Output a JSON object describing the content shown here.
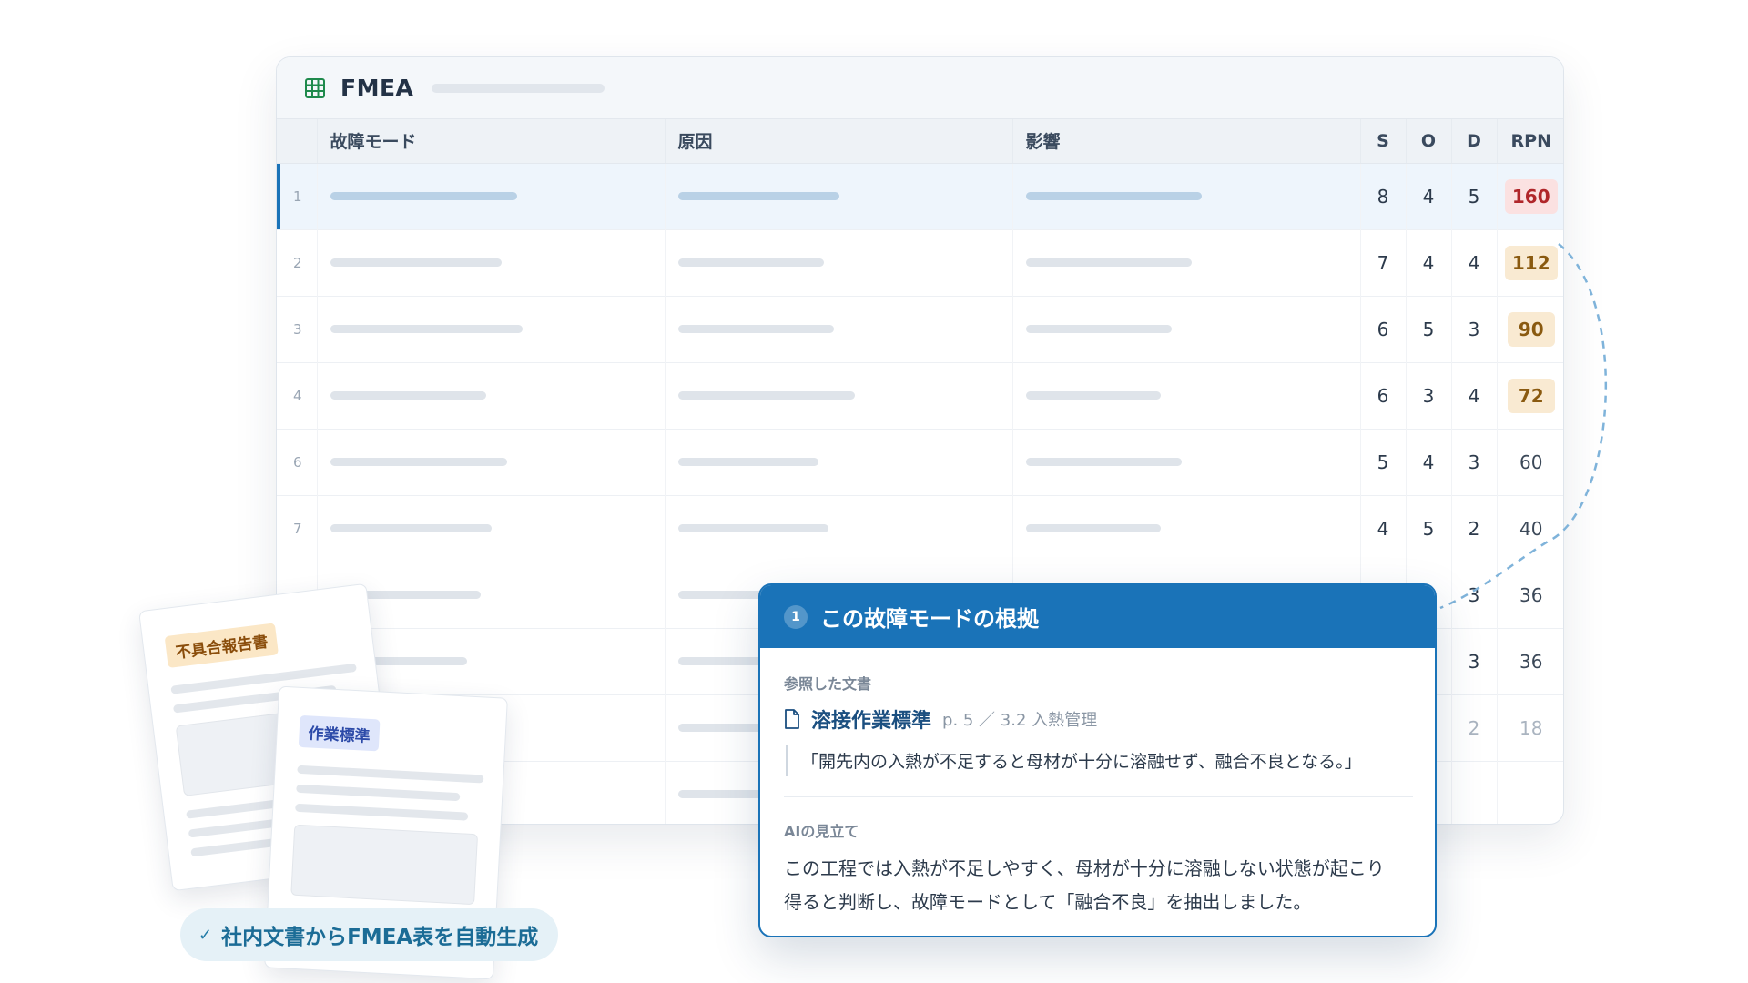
{
  "fmea": {
    "title": "FMEA",
    "columns": {
      "failure_mode": "故障モード",
      "cause": "原因",
      "effect": "影響",
      "s": "S",
      "o": "O",
      "d": "D",
      "rpn": "RPN"
    },
    "rows": [
      {
        "no": "1",
        "s": "8",
        "o": "4",
        "d": "5",
        "rpn": "160",
        "level": "high"
      },
      {
        "no": "2",
        "s": "7",
        "o": "4",
        "d": "4",
        "rpn": "112",
        "level": "mid"
      },
      {
        "no": "3",
        "s": "6",
        "o": "5",
        "d": "3",
        "rpn": "90",
        "level": "mid"
      },
      {
        "no": "4",
        "s": "6",
        "o": "3",
        "d": "4",
        "rpn": "72",
        "level": "mid"
      },
      {
        "no": "6",
        "s": "5",
        "o": "4",
        "d": "3",
        "rpn": "60",
        "level": "low"
      },
      {
        "no": "7",
        "s": "4",
        "o": "5",
        "d": "2",
        "rpn": "40",
        "level": "low"
      },
      {
        "no": "",
        "s": "",
        "o": "",
        "d": "3",
        "rpn": "36",
        "level": "low"
      },
      {
        "no": "",
        "s": "",
        "o": "",
        "d": "3",
        "rpn": "36",
        "level": "low"
      },
      {
        "no": "",
        "s": "",
        "o": "",
        "d": "2",
        "rpn": "18",
        "level": "faded"
      },
      {
        "no": "",
        "s": "",
        "o": "",
        "d": "",
        "rpn": "",
        "level": "faded"
      }
    ]
  },
  "documents": {
    "report_tag": "不具合報告書",
    "standard_tag": "作業標準"
  },
  "badge": {
    "label": "社内文書からFMEA表を自動生成"
  },
  "evidence": {
    "number": "1",
    "title": "この故障モードの根拠",
    "referenced_label": "参照した文書",
    "doc_name": "溶接作業標準",
    "doc_location": "p. 5 ／ 3.2 入熱管理",
    "quote": "「開先内の入熱が不足すると母材が十分に溶融せず、融合不良となる。」",
    "ai_label": "AIの見立て",
    "ai_text_line1": "この工程では入熱が不足しやすく、母材が十分に溶融しない状態が起こり",
    "ai_text_line2": "得ると判断し、故障モードとして「融合不良」を抽出しました。"
  },
  "colors": {
    "accent": "#1a73b8",
    "rpn_high_bg": "#fbe1e1",
    "rpn_mid_bg": "#f9ead2",
    "badge_bg": "#e5f1f7"
  }
}
